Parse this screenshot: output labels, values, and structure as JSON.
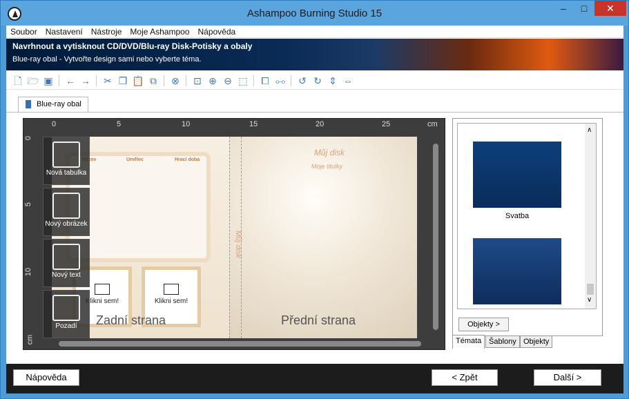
{
  "window": {
    "title": "Ashampoo Burning Studio 15",
    "minimize": "–",
    "maximize": "□",
    "close": "✕"
  },
  "menu": [
    "Soubor",
    "Nastavení",
    "Nástroje",
    "Moje Ashampoo",
    "Nápověda"
  ],
  "banner": {
    "title": "Navrhnout a vytisknout CD/DVD/Blu-ray Disk-Potisky a obaly",
    "subtitle": "Blue-ray obal - Vytvořte design sami nebo vyberte téma."
  },
  "toolbar_icons": [
    "new-icon",
    "open-icon",
    "save-icon",
    "undo-arrow-icon",
    "redo-arrow-icon",
    "cut-icon",
    "copy-icon",
    "paste-icon",
    "duplicate-icon",
    "delete-icon",
    "zoom-fit-icon",
    "zoom-in-icon",
    "zoom-out-icon",
    "zoom-select-icon",
    "bring-front-icon",
    "send-back-icon",
    "rotate-left-icon",
    "rotate-right-icon",
    "flip-vertical-icon",
    "flip-horizontal-icon"
  ],
  "doc_tab": {
    "label": "Blue-ray obal"
  },
  "ruler": {
    "unit": "cm",
    "top_ticks": [
      "0",
      "5",
      "10",
      "15",
      "20",
      "25"
    ],
    "left_ticks": [
      "0",
      "5",
      "10"
    ]
  },
  "tools": {
    "table": "Nová tabulka",
    "image": "Nový obrázek",
    "text": "Nový text",
    "background": "Pozadí"
  },
  "cover": {
    "columns": [
      "Název",
      "Umělec",
      "Hrací doba"
    ],
    "photo1": "Klikni sem!",
    "photo2": "Klikni sem!",
    "back_label": "Zadní strana",
    "front_label": "Přední strana",
    "front_title": "Můj disk",
    "front_subtitle": "Moje titulky",
    "spine_text": "Můj disk"
  },
  "panel": {
    "themes": [
      {
        "name": "Svatba"
      },
      {
        "name": ""
      }
    ],
    "objects_button": "Objekty >",
    "tabs": [
      "Témata",
      "Šablony",
      "Objekty"
    ]
  },
  "footer": {
    "help": "Nápověda",
    "back": "< Zpět",
    "next": "Další >"
  }
}
